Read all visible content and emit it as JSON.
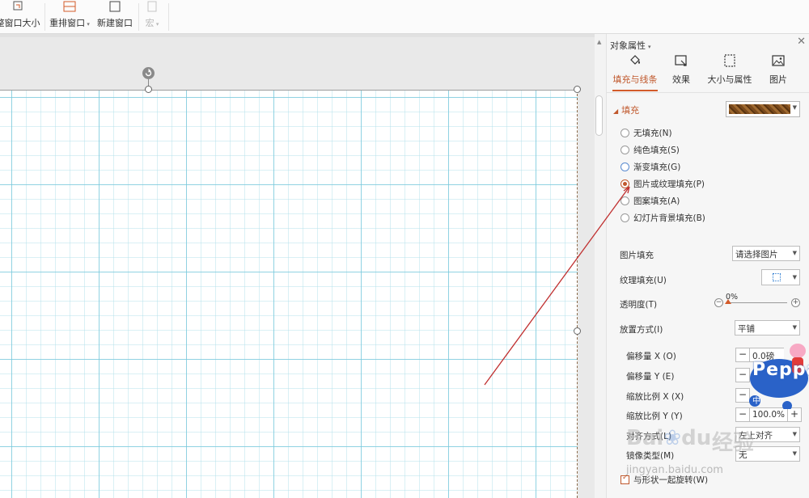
{
  "ribbon": {
    "buttons": [
      {
        "label": "整窗口大小",
        "icon": "resize-window-icon",
        "enabled": true
      },
      {
        "label": "重排窗口",
        "icon": "arrange-windows-icon",
        "enabled": true,
        "has_dropdown": true
      },
      {
        "label": "新建窗口",
        "icon": "new-window-icon",
        "enabled": true
      },
      {
        "label": "宏",
        "icon": "macro-icon",
        "enabled": false,
        "has_dropdown": true
      }
    ]
  },
  "pane": {
    "title": "对象属性",
    "tabs": [
      {
        "label": "填充与线条",
        "icon": "fill-bucket-icon",
        "active": true
      },
      {
        "label": "效果",
        "icon": "effects-icon",
        "active": false
      },
      {
        "label": "大小与属性",
        "icon": "size-properties-icon",
        "active": false
      },
      {
        "label": "图片",
        "icon": "picture-icon",
        "active": false
      }
    ],
    "fill": {
      "section_label": "填充",
      "options": [
        {
          "label": "无填充(N)",
          "selected": false
        },
        {
          "label": "纯色填充(S)",
          "selected": false
        },
        {
          "label": "渐变填充(G)",
          "selected": false
        },
        {
          "label": "图片或纹理填充(P)",
          "selected": true
        },
        {
          "label": "图案填充(A)",
          "selected": false
        },
        {
          "label": "幻灯片背景填充(B)",
          "selected": false
        }
      ],
      "picture_fill_label": "图片填充",
      "picture_fill_value": "请选择图片",
      "texture_fill_label": "纹理填充(U)",
      "transparency_label": "透明度(T)",
      "transparency_value": "0%",
      "placement_label": "放置方式(I)",
      "placement_value": "平铺",
      "offset_x_label": "偏移量 X (O)",
      "offset_x_value": "0.0磅",
      "offset_y_label": "偏移量 Y (E)",
      "scale_x_label": "缩放比例 X (X)",
      "scale_y_label": "缩放比例 Y (Y)",
      "scale_y_value": "100.0%",
      "align_label": "对齐方式(L)",
      "align_value": "左上对齐",
      "mirror_label": "镜像类型(M)",
      "mirror_value": "无",
      "rotate_with_shape_label": "与形状一起旋转(W)",
      "rotate_with_shape_checked": true
    }
  },
  "watermarks": {
    "peppa_text": "Peppa",
    "peppa_sub": "中",
    "baidu_text": "Bai",
    "baidu_du": "du",
    "baidu_cn": "经验",
    "baidu_url": "jingyan.baidu.com"
  },
  "colors": {
    "accent": "#d35b2a",
    "grid_line": "#9fd6e3",
    "annotation_arrow": "#c03030"
  }
}
